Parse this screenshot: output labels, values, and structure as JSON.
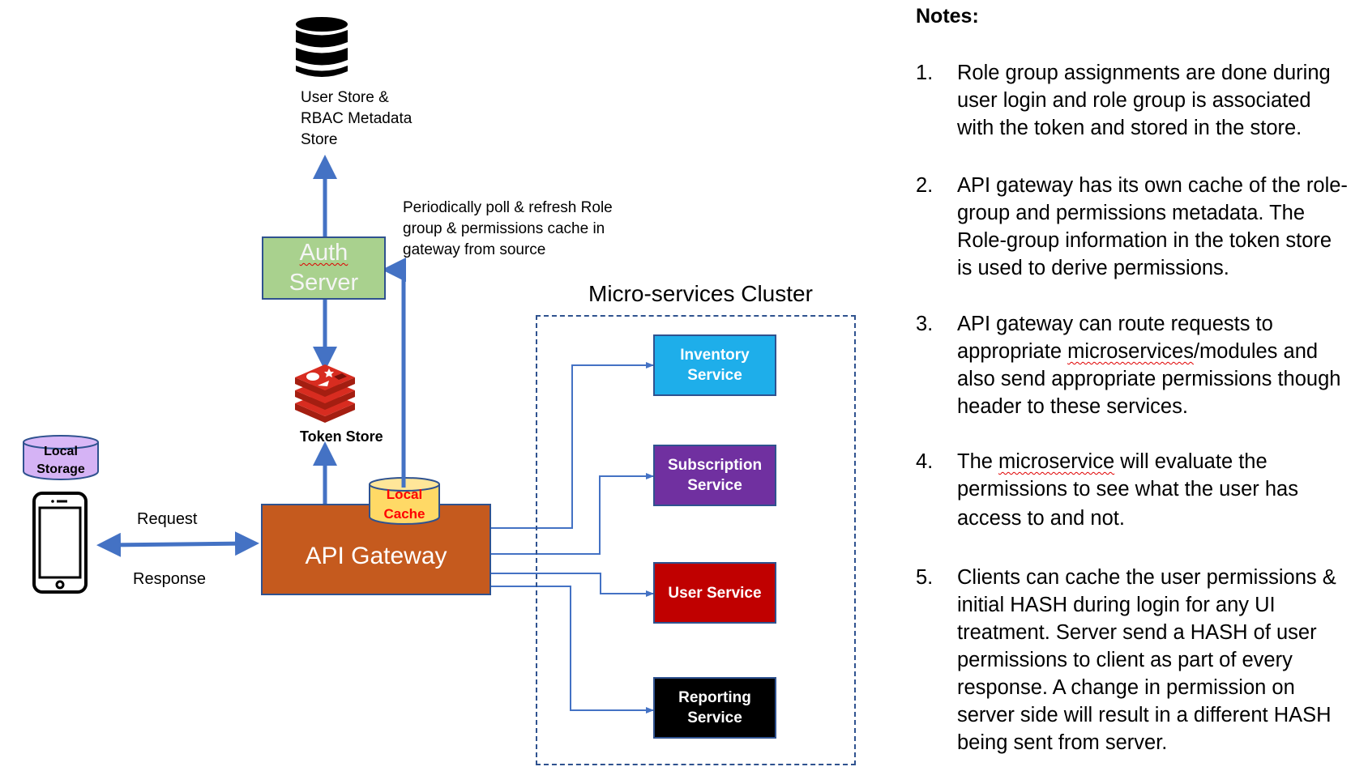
{
  "user_store": {
    "icon": "database-icon",
    "label_lines": [
      "User Store &",
      "RBAC Metadata",
      "Store"
    ]
  },
  "auth_server": {
    "line1": "Auth",
    "line2": "Server",
    "color": "#a9d18e"
  },
  "refresh_note": {
    "lines": [
      "Periodically poll & refresh Role",
      "group & permissions cache  in",
      "gateway from source"
    ]
  },
  "token_store": {
    "icon": "redis-icon",
    "label": "Token Store",
    "color": "#d82c20"
  },
  "local_storage": {
    "line1": "Local",
    "line2": "Storage",
    "color": "#d5b3f5"
  },
  "client": {
    "icon": "smartphone-icon"
  },
  "request_label": "Request",
  "response_label": "Response",
  "api_gateway": {
    "label": "API Gateway",
    "color": "#c55a1e"
  },
  "local_cache": {
    "line1": "Local",
    "line2": "Cache",
    "color": "#ffd966",
    "text_color": "#ff0000"
  },
  "cluster": {
    "title": "Micro-services Cluster",
    "services": [
      {
        "line1": "Inventory",
        "line2": "Service",
        "color": "#1eaeea"
      },
      {
        "line1": "Subscription",
        "line2": "Service",
        "color": "#7030a0"
      },
      {
        "line1": "User Service",
        "line2": "",
        "color": "#c00000"
      },
      {
        "line1": "Reporting",
        "line2": "Service",
        "color": "#000000"
      }
    ]
  },
  "notes": {
    "title": "Notes:",
    "items": [
      {
        "num": "1.",
        "lines": [
          "Role group assignments are done during",
          "user login and role group is associated",
          "with the token and stored in the store."
        ]
      },
      {
        "num": "2.",
        "lines": [
          "API gateway has its own cache of the role-",
          "group and permissions metadata.  The",
          "Role-group information in the token store",
          "is used to derive permissions."
        ]
      },
      {
        "num": "3.",
        "lines": [
          "API gateway can route requests to",
          "appropriate microservices/modules and",
          "also send appropriate permissions though",
          "header to these services."
        ]
      },
      {
        "num": "4.",
        "lines": [
          "The microservice will evaluate the",
          "permissions to see what the user has",
          "access to and not."
        ]
      },
      {
        "num": "5.",
        "lines": [
          "Clients can cache the user permissions &",
          "initial HASH during login for any UI",
          "treatment. Server send a HASH of user",
          "permissions to client as part of every",
          "response. A change in permission on",
          "server side will result in a different HASH",
          "being sent from server."
        ]
      }
    ]
  },
  "colors": {
    "arrow": "#4472c4",
    "border": "#2f528f"
  }
}
